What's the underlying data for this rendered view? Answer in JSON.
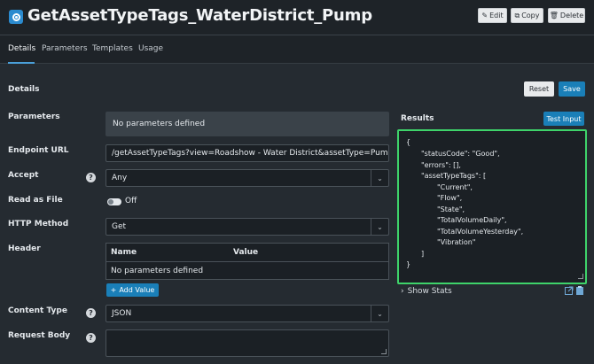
{
  "header": {
    "title": "GetAssetTypeTags_WaterDistrict_Pump",
    "edit_label": "Edit",
    "copy_label": "Copy",
    "delete_label": "Delete"
  },
  "tabs": [
    {
      "label": "Details"
    },
    {
      "label": "Parameters"
    },
    {
      "label": "Templates"
    },
    {
      "label": "Usage"
    }
  ],
  "details": {
    "section_title": "Details",
    "reset_label": "Reset",
    "save_label": "Save"
  },
  "form": {
    "parameters_label": "Parameters",
    "parameters_empty": "No parameters defined",
    "endpoint_label": "Endpoint URL",
    "endpoint_value": "/getAssetTypeTags?view=Roadshow - Water District&assetType=Pump",
    "accept_label": "Accept",
    "accept_value": "Any",
    "read_as_file_label": "Read as File",
    "read_as_file_state": "Off",
    "http_method_label": "HTTP Method",
    "http_method_value": "Get",
    "header_label": "Header",
    "header_col_name": "Name",
    "header_col_value": "Value",
    "header_empty": "No parameters defined",
    "add_value_label": "Add Value",
    "content_type_label": "Content Type",
    "content_type_value": "JSON",
    "request_body_label": "Request Body",
    "help_glyph": "?"
  },
  "results": {
    "title": "Results",
    "test_label": "Test Input",
    "lines": [
      "{",
      "\"statusCode\": \"Good\",",
      "\"errors\": [],",
      "\"assetTypeTags\": [",
      "\"Current\",",
      "\"Flow\",",
      "\"State\",",
      "\"TotalVolumeDaily\",",
      "\"TotalVolumeYesterday\",",
      "\"Vibration\"",
      "]",
      "}"
    ],
    "show_stats_label": "Show Stats"
  },
  "colors": {
    "accent": "#1a7fb8",
    "results_border": "#3ed36a",
    "background": "#252b31"
  }
}
